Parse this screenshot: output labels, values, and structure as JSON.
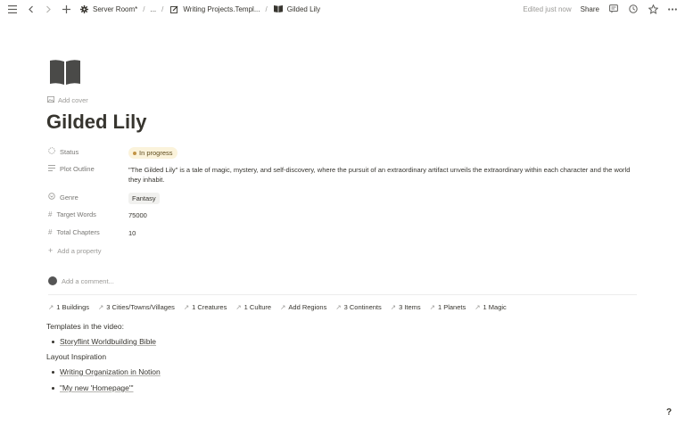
{
  "topbar": {
    "crumbs": [
      "Server Room*",
      "...",
      "Writing Projects.Templ...",
      "Gilded Lily"
    ],
    "edited": "Edited just now",
    "share": "Share"
  },
  "page": {
    "add_cover": "Add cover",
    "title": "Gilded Lily"
  },
  "properties": {
    "status": {
      "label": "Status",
      "value": "In progress"
    },
    "plot": {
      "label": "Plot Outline",
      "value": "\"The Gilded Lily\" is a tale of magic, mystery, and self-discovery, where the pursuit of an extraordinary artifact unveils the extraordinary within each character and the world they inhabit."
    },
    "genre": {
      "label": "Genre",
      "value": "Fantasy"
    },
    "target_words": {
      "label": "Target Words",
      "value": "75000"
    },
    "total_chapters": {
      "label": "Total Chapters",
      "value": "10"
    },
    "add_property": "Add a property"
  },
  "comment_placeholder": "Add a comment...",
  "relations": [
    "1 Buildings",
    "3 Cities/Towns/Villages",
    "1 Creatures",
    "1 Culture",
    "Add Regions",
    "3 Continents",
    "3 Items",
    "1 Planets",
    "1 Magic"
  ],
  "body": {
    "templates_heading": "Templates in the video:",
    "templates_links": [
      "Storyflint Worldbuilding Bible"
    ],
    "layout_heading": "Layout Inspiration",
    "layout_links": [
      "Writing Organization in Notion",
      "\"My new 'Homepage'\""
    ]
  },
  "help": "?",
  "colors": {
    "status_bg": "#fbf3db",
    "status_dot": "#c29343",
    "text": "#37352f",
    "muted": "#9b9a97"
  }
}
